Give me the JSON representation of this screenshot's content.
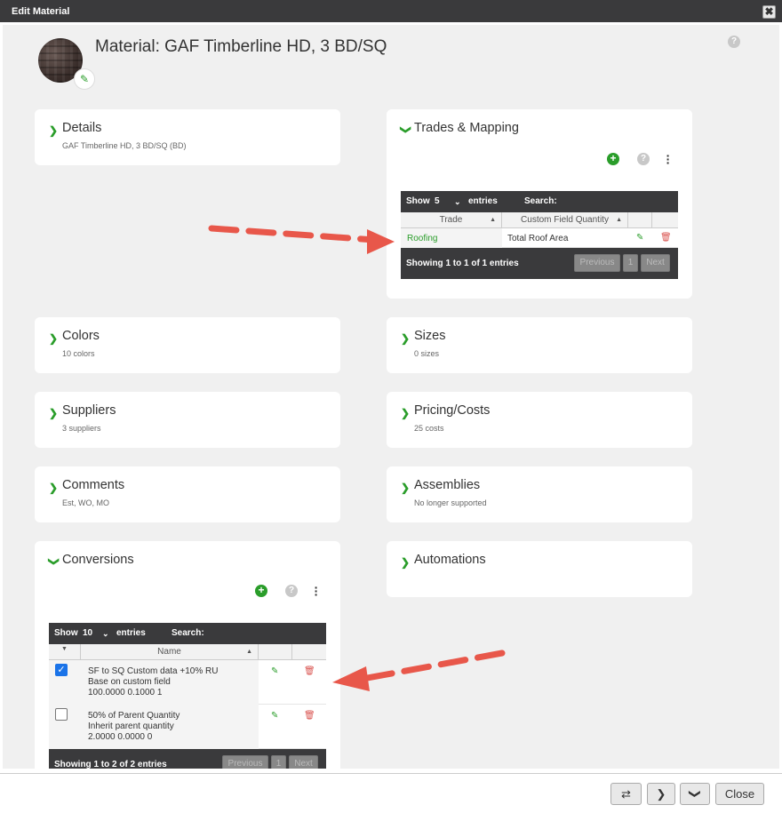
{
  "window": {
    "title": "Edit Material",
    "close_label": "✖"
  },
  "header": {
    "title": "Material: GAF Timberline HD, 3 BD/SQ",
    "help": "?"
  },
  "cards": {
    "details": {
      "title": "Details",
      "subtitle": "GAF Timberline HD, 3 BD/SQ (BD)"
    },
    "trades": {
      "title": "Trades & Mapping"
    },
    "colors": {
      "title": "Colors",
      "subtitle": "10 colors"
    },
    "sizes": {
      "title": "Sizes",
      "subtitle": "0 sizes"
    },
    "suppliers": {
      "title": "Suppliers",
      "subtitle": "3 suppliers"
    },
    "pricing": {
      "title": "Pricing/Costs",
      "subtitle": "25 costs"
    },
    "comments": {
      "title": "Comments",
      "subtitle": "Est, WO, MO"
    },
    "assemblies": {
      "title": "Assemblies",
      "subtitle": "No longer supported"
    },
    "conversions": {
      "title": "Conversions"
    },
    "automations": {
      "title": "Automations"
    }
  },
  "trades_table": {
    "show_label": "Show",
    "show_value": "5",
    "entries_label": "entries",
    "search_label": "Search:",
    "columns": [
      "Trade",
      "Custom Field Quantity"
    ],
    "rows": [
      {
        "trade": "Roofing",
        "quantity": "Total Roof Area"
      }
    ],
    "info": "Showing 1 to 1 of 1 entries",
    "prev": "Previous",
    "page": "1",
    "next": "Next"
  },
  "conversions_table": {
    "show_label": "Show",
    "show_value": "10",
    "entries_label": "entries",
    "search_label": "Search:",
    "columns": [
      "Name"
    ],
    "rows": [
      {
        "line1": "SF to SQ Custom data +10% RU",
        "line2": "Base on custom field",
        "line3": "100.0000 0.1000 1",
        "checked": true
      },
      {
        "line1": "50% of Parent Quantity",
        "line2": "Inherit parent quantity",
        "line3": "2.0000 0.0000 0",
        "checked": false
      }
    ],
    "info": "Showing 1 to 2 of 2 entries",
    "prev": "Previous",
    "page": "1",
    "next": "Next"
  },
  "footer": {
    "close_label": "Close"
  },
  "colors": {
    "accent": "#2a9d2a",
    "danger": "#d9534f",
    "arrow": "#e8574a",
    "dark": "#3a3a3c"
  },
  "icons": [
    "pencil-icon",
    "trash-icon",
    "add-icon",
    "help-icon",
    "kebab-icon",
    "chevron-right-icon",
    "chevron-down-icon",
    "swap-icon"
  ]
}
